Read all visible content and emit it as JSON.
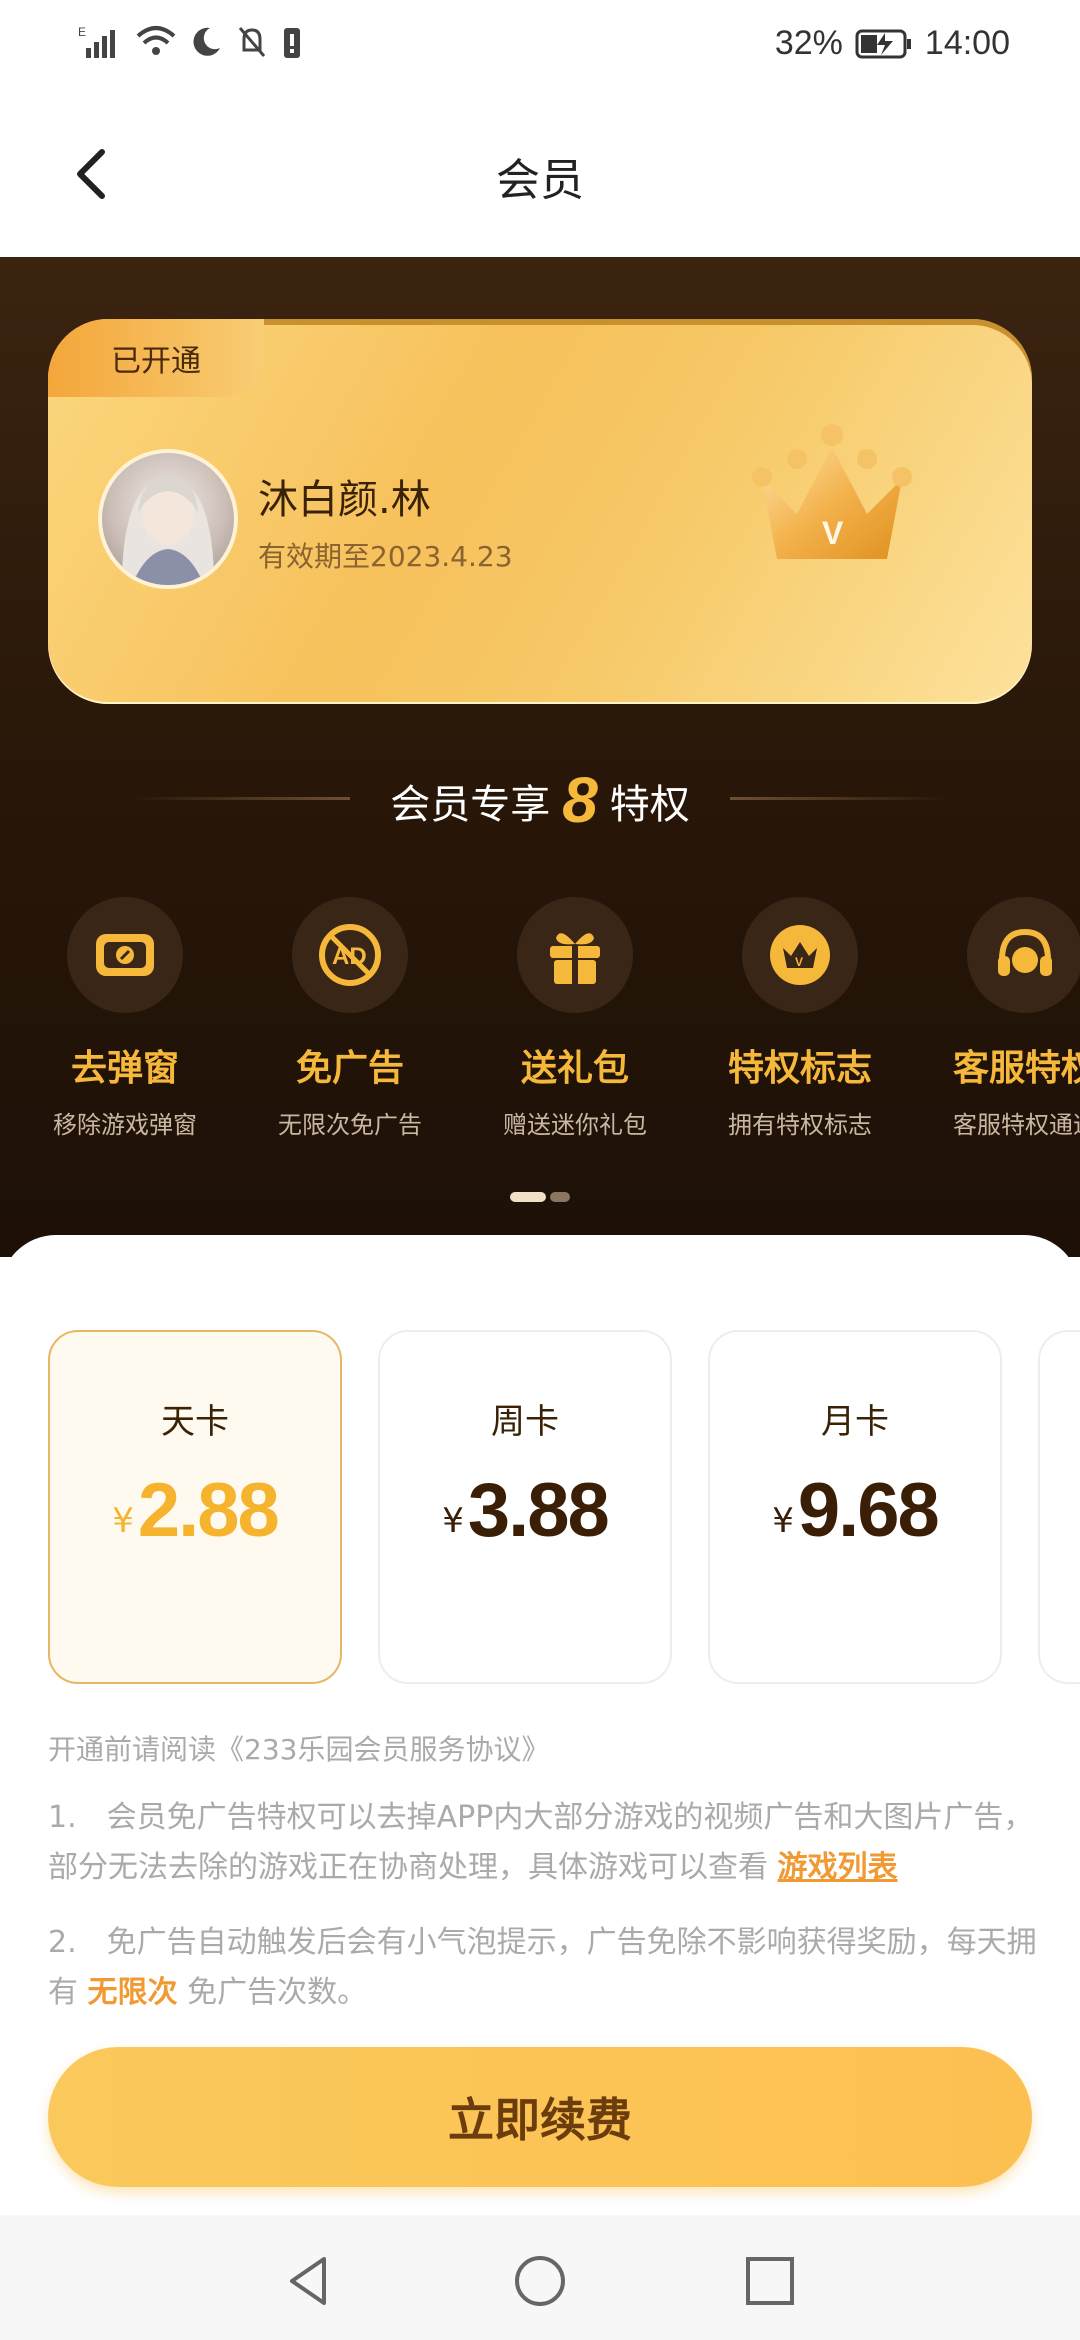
{
  "status_bar": {
    "battery": "32%",
    "time": "14:00"
  },
  "nav": {
    "title": "会员"
  },
  "member_card": {
    "badge": "已开通",
    "user_name": "沐白颜.林",
    "valid_until": "有效期至2023.4.23"
  },
  "privileges": {
    "title_prefix": "会员专享",
    "count": "8",
    "title_suffix": "特权",
    "items": [
      {
        "name": "去弹窗",
        "desc": "移除游戏弹窗",
        "icon": "popup-window-icon"
      },
      {
        "name": "免广告",
        "desc": "无限次免广告",
        "icon": "no-ad-icon"
      },
      {
        "name": "送礼包",
        "desc": "赠送迷你礼包",
        "icon": "gift-icon"
      },
      {
        "name": "特权标志",
        "desc": "拥有特权标志",
        "icon": "crown-badge-icon"
      },
      {
        "name": "客服特权",
        "desc": "客服特权通道",
        "icon": "headset-icon"
      }
    ]
  },
  "plans": [
    {
      "name": "天卡",
      "currency": "¥",
      "price": "2.88",
      "selected": true
    },
    {
      "name": "周卡",
      "currency": "¥",
      "price": "3.88",
      "selected": false
    },
    {
      "name": "月卡",
      "currency": "¥",
      "price": "9.68",
      "selected": false
    }
  ],
  "notes": {
    "agreement": "开通前请阅读《233乐园会员服务协议》",
    "note1_text": "1.　会员免广告特权可以去掉APP内大部分游戏的视频广告和大图片广告，部分无法去除的游戏正在协商处理，具体游戏可以查看",
    "note1_link": "游戏列表",
    "note2_text": "2.　免广告自动触发后会有小气泡提示，广告免除不影响获得奖励，每天拥有",
    "note2_highlight": "无限次",
    "note2_suffix": "免广告次数。"
  },
  "renew_button": "立即续费",
  "colors": {
    "accent": "#f6b83a",
    "button": "#fcc051",
    "hero_bg": "#2a1809"
  }
}
